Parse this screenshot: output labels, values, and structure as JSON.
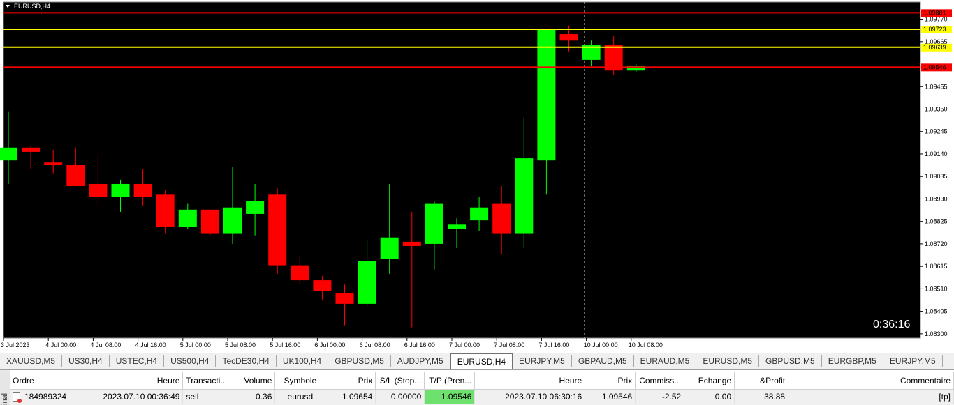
{
  "chart_data": {
    "type": "candlestick",
    "title": "EURUSD,H4",
    "timer": "0:36:16",
    "colors": {
      "background": "#000000",
      "bull": "#00ff00",
      "bear": "#ff0000",
      "level_yellow": "#ffff00",
      "level_red": "#ff0000"
    },
    "ylim": [
      1.0828,
      1.0985
    ],
    "y_ticks": [
      "1.09770",
      "1.09665",
      "1.09455",
      "1.09350",
      "1.09245",
      "1.09140",
      "1.09035",
      "1.08930",
      "1.08825",
      "1.08720",
      "1.08615",
      "1.08510",
      "1.08405",
      "1.08300"
    ],
    "x_labels": [
      {
        "i": 0,
        "label": "3 Jul 2023"
      },
      {
        "i": 2,
        "label": "4 Jul 00:00"
      },
      {
        "i": 4,
        "label": "4 Jul 08:00"
      },
      {
        "i": 6,
        "label": "4 Jul 16:00"
      },
      {
        "i": 8,
        "label": "5 Jul 00:00"
      },
      {
        "i": 10,
        "label": "5 Jul 08:00"
      },
      {
        "i": 12,
        "label": "5 Jul 16:00"
      },
      {
        "i": 14,
        "label": "6 Jul 00:00"
      },
      {
        "i": 16,
        "label": "6 Jul 08:00"
      },
      {
        "i": 18,
        "label": "6 Jul 16:00"
      },
      {
        "i": 20,
        "label": "7 Jul 00:00"
      },
      {
        "i": 22,
        "label": "7 Jul 08:00"
      },
      {
        "i": 24,
        "label": "7 Jul 16:00"
      },
      {
        "i": 26,
        "label": "10 Jul 00:00"
      },
      {
        "i": 28,
        "label": "10 Jul 08:00"
      }
    ],
    "candles": [
      {
        "o": 1.0911,
        "h": 1.0934,
        "l": 1.09,
        "c": 1.0917
      },
      {
        "o": 1.0917,
        "h": 1.0918,
        "l": 1.0907,
        "c": 1.0915
      },
      {
        "o": 1.091,
        "h": 1.0916,
        "l": 1.0905,
        "c": 1.0909
      },
      {
        "o": 1.0909,
        "h": 1.0917,
        "l": 1.0899,
        "c": 1.0899
      },
      {
        "o": 1.09,
        "h": 1.0914,
        "l": 1.089,
        "c": 1.0894
      },
      {
        "o": 1.0894,
        "h": 1.0902,
        "l": 1.0887,
        "c": 1.09
      },
      {
        "o": 1.09,
        "h": 1.0907,
        "l": 1.089,
        "c": 1.0894
      },
      {
        "o": 1.0895,
        "h": 1.0897,
        "l": 1.0877,
        "c": 1.088
      },
      {
        "o": 1.088,
        "h": 1.0891,
        "l": 1.0879,
        "c": 1.0888
      },
      {
        "o": 1.0888,
        "h": 1.0888,
        "l": 1.0876,
        "c": 1.0877
      },
      {
        "o": 1.0877,
        "h": 1.0908,
        "l": 1.0872,
        "c": 1.0889
      },
      {
        "o": 1.0886,
        "h": 1.09,
        "l": 1.0876,
        "c": 1.0892
      },
      {
        "o": 1.0895,
        "h": 1.0898,
        "l": 1.0858,
        "c": 1.0862
      },
      {
        "o": 1.0862,
        "h": 1.0866,
        "l": 1.0853,
        "c": 1.0855
      },
      {
        "o": 1.0855,
        "h": 1.0857,
        "l": 1.0846,
        "c": 1.085
      },
      {
        "o": 1.0849,
        "h": 1.0853,
        "l": 1.0834,
        "c": 1.0844
      },
      {
        "o": 1.0844,
        "h": 1.0874,
        "l": 1.0843,
        "c": 1.0864
      },
      {
        "o": 1.0865,
        "h": 1.09,
        "l": 1.0858,
        "c": 1.0875
      },
      {
        "o": 1.0873,
        "h": 1.0887,
        "l": 1.0833,
        "c": 1.0871
      },
      {
        "o": 1.0872,
        "h": 1.0892,
        "l": 1.086,
        "c": 1.0891
      },
      {
        "o": 1.0879,
        "h": 1.0884,
        "l": 1.087,
        "c": 1.0881
      },
      {
        "o": 1.0883,
        "h": 1.0894,
        "l": 1.0878,
        "c": 1.0889
      },
      {
        "o": 1.0891,
        "h": 1.0899,
        "l": 1.0867,
        "c": 1.0877
      },
      {
        "o": 1.0877,
        "h": 1.0931,
        "l": 1.087,
        "c": 1.0912
      },
      {
        "o": 1.0911,
        "h": 1.0972,
        "l": 1.0895,
        "c": 1.0972
      },
      {
        "o": 1.097,
        "h": 1.0974,
        "l": 1.0962,
        "c": 1.0967
      },
      {
        "o": 1.0958,
        "h": 1.0967,
        "l": 1.0955,
        "c": 1.0965
      },
      {
        "o": 1.0965,
        "h": 1.0969,
        "l": 1.0951,
        "c": 1.0953
      },
      {
        "o": 1.0953,
        "h": 1.0956,
        "l": 1.0952,
        "c": 1.0955
      }
    ],
    "levels": [
      {
        "price": 1.098,
        "label": "1.09801",
        "color": "#ff0000"
      },
      {
        "price": 1.09723,
        "label": "1.09723",
        "color": "#ffff00"
      },
      {
        "price": 1.09639,
        "label": "1.09639",
        "color": "#ffff00"
      },
      {
        "price": 1.09546,
        "label": "1.09546",
        "color": "#ff0000"
      }
    ]
  },
  "tabs": [
    "XAUUSD,M5",
    "US30,H4",
    "USTEC,H4",
    "US500,H4",
    "TecDE30,H4",
    "UK100,H4",
    "GBPUSD,M5",
    "AUDJPY,M5",
    "EURUSD,H4",
    "EURJPY,M5",
    "GBPAUD,M5",
    "EURAUD,M5",
    "EURUSD,M5",
    "GBPUSD,M5",
    "EURGBP,M5",
    "EURJPY,M5"
  ],
  "active_tab": "EURUSD,H4",
  "terminal": {
    "side_label": "inal",
    "columns": [
      "Ordre",
      "Heure",
      "Transacti...",
      "Volume",
      "Symbole",
      "Prix",
      "S/L (Stop...",
      "T/P (Pren...",
      "Heure",
      "Prix",
      "Commiss...",
      "Echange",
      "&Profit",
      "Commentaire"
    ],
    "rows": [
      [
        "184989324",
        "2023.07.10 00:36:49",
        "sell",
        "0.36",
        "eurusd",
        "1.09654",
        "0.00000",
        "1.09546",
        "2023.07.10 06:30:16",
        "1.09546",
        "-2.52",
        "0.00",
        "38.88",
        "[tp]"
      ]
    ]
  }
}
